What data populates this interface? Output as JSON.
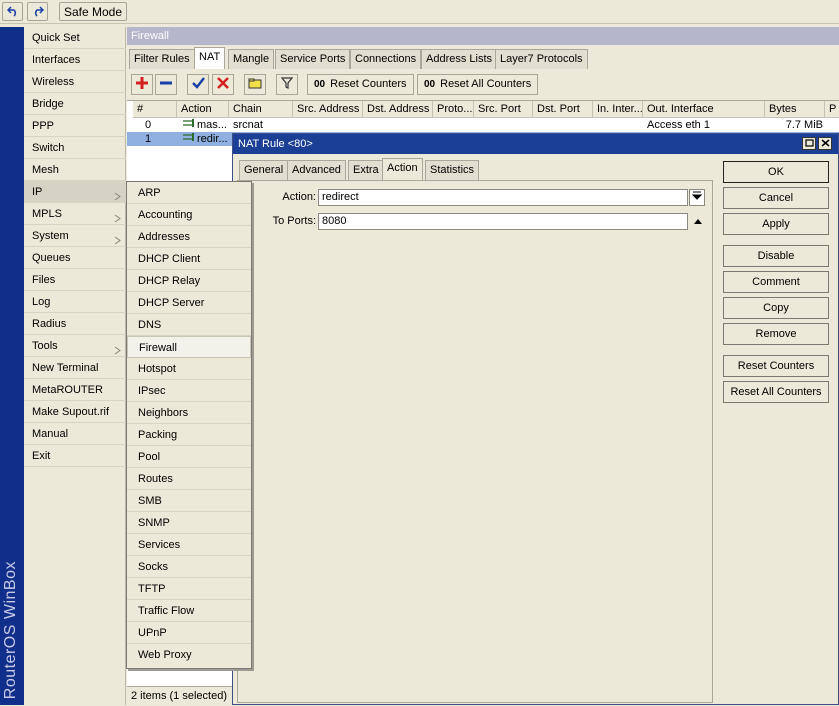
{
  "toolbar": {
    "undo_icon": "undo-icon",
    "redo_icon": "redo-icon",
    "safe_mode": "Safe Mode"
  },
  "brand": {
    "text": "RouterOS WinBox"
  },
  "main_menu": {
    "items": [
      {
        "label": "Quick Set"
      },
      {
        "label": "Interfaces"
      },
      {
        "label": "Wireless"
      },
      {
        "label": "Bridge"
      },
      {
        "label": "PPP"
      },
      {
        "label": "Switch"
      },
      {
        "label": "Mesh"
      },
      {
        "label": "IP"
      },
      {
        "label": "MPLS"
      },
      {
        "label": "System"
      },
      {
        "label": "Queues"
      },
      {
        "label": "Files"
      },
      {
        "label": "Log"
      },
      {
        "label": "Radius"
      },
      {
        "label": "Tools"
      },
      {
        "label": "New Terminal"
      },
      {
        "label": "MetaROUTER"
      },
      {
        "label": "Make Supout.rif"
      },
      {
        "label": "Manual"
      },
      {
        "label": "Exit"
      }
    ]
  },
  "ip_submenu": {
    "items": [
      {
        "label": "ARP"
      },
      {
        "label": "Accounting"
      },
      {
        "label": "Addresses"
      },
      {
        "label": "DHCP Client"
      },
      {
        "label": "DHCP Relay"
      },
      {
        "label": "DHCP Server"
      },
      {
        "label": "DNS"
      },
      {
        "label": "Firewall"
      },
      {
        "label": "Hotspot"
      },
      {
        "label": "IPsec"
      },
      {
        "label": "Neighbors"
      },
      {
        "label": "Packing"
      },
      {
        "label": "Pool"
      },
      {
        "label": "Routes"
      },
      {
        "label": "SMB"
      },
      {
        "label": "SNMP"
      },
      {
        "label": "Services"
      },
      {
        "label": "Socks"
      },
      {
        "label": "TFTP"
      },
      {
        "label": "Traffic Flow"
      },
      {
        "label": "UPnP"
      },
      {
        "label": "Web Proxy"
      }
    ]
  },
  "firewall": {
    "title": "Firewall",
    "tabs": [
      {
        "label": "Filter Rules"
      },
      {
        "label": "NAT"
      },
      {
        "label": "Mangle"
      },
      {
        "label": "Service Ports"
      },
      {
        "label": "Connections"
      },
      {
        "label": "Address Lists"
      },
      {
        "label": "Layer7 Protocols"
      }
    ],
    "reset_counters": "Reset Counters",
    "reset_all_counters": "Reset All Counters",
    "oo": "00",
    "columns": [
      {
        "label": "#"
      },
      {
        "label": "Action"
      },
      {
        "label": "Chain"
      },
      {
        "label": "Src. Address"
      },
      {
        "label": "Dst. Address"
      },
      {
        "label": "Proto..."
      },
      {
        "label": "Src. Port"
      },
      {
        "label": "Dst. Port"
      },
      {
        "label": "In. Inter..."
      },
      {
        "label": "Out. Interface"
      },
      {
        "label": "Bytes"
      },
      {
        "label": "P"
      }
    ],
    "rows": [
      {
        "num": "0",
        "action": "mas...",
        "chain": "srcnat",
        "out_interface": "Access eth 1",
        "bytes": "7.7 MiB"
      },
      {
        "num": "1",
        "action": "redir...",
        "chain": "",
        "out_interface": "",
        "bytes": ""
      }
    ],
    "status": "2 items (1 selected)"
  },
  "nat_rule": {
    "title": "NAT Rule <80>",
    "tabs": [
      {
        "label": "General"
      },
      {
        "label": "Advanced"
      },
      {
        "label": "Extra"
      },
      {
        "label": "Action"
      },
      {
        "label": "Statistics"
      }
    ],
    "action_label": "Action:",
    "action_value": "redirect",
    "to_ports_label": "To Ports:",
    "to_ports_value": "8080",
    "buttons": {
      "ok": "OK",
      "cancel": "Cancel",
      "apply": "Apply",
      "disable": "Disable",
      "comment": "Comment",
      "copy": "Copy",
      "remove": "Remove",
      "reset_counters": "Reset Counters",
      "reset_all_counters": "Reset All Counters"
    }
  },
  "colors": {
    "brand_bar": "#0f2f8a",
    "dialog_title": "#1b3f95",
    "selection": "#8fb0e0",
    "add_red": "#d42020",
    "remove_blue": "#1a3fa8"
  }
}
